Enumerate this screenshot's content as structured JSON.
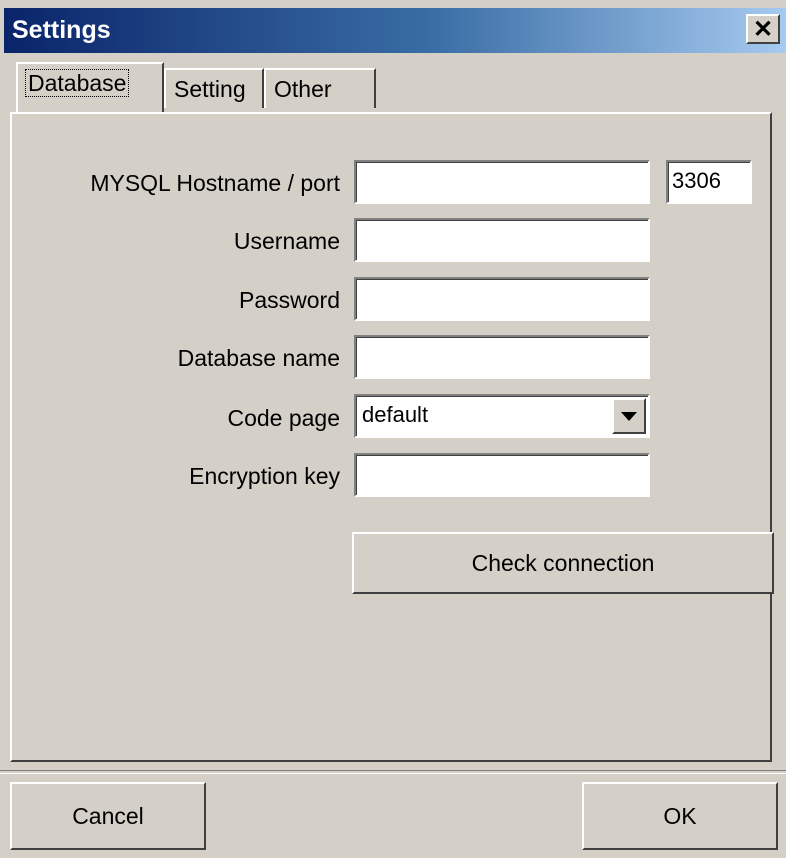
{
  "window": {
    "title": "Settings",
    "close_glyph": "✕"
  },
  "tabs": [
    {
      "label": "Database",
      "active": true
    },
    {
      "label": "Setting",
      "active": false
    },
    {
      "label": "Other",
      "active": false
    }
  ],
  "form": {
    "hostname_label": "MYSQL Hostname / port",
    "hostname_value": "",
    "port_value": "3306",
    "username_label": "Username",
    "username_value": "",
    "password_label": "Password",
    "password_value": "",
    "dbname_label": "Database name",
    "dbname_value": "",
    "codepage_label": "Code page",
    "codepage_value": "default",
    "enckey_label": "Encryption key",
    "enckey_value": ""
  },
  "buttons": {
    "check_connection": "Check connection",
    "cancel": "Cancel",
    "ok": "OK"
  },
  "icons": {
    "close": "close-icon",
    "dropdown": "chevron-down-icon"
  }
}
